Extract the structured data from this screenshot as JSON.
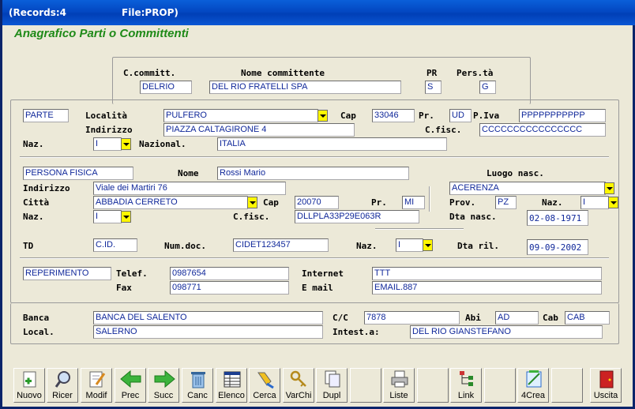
{
  "window": {
    "records": "(Records:4",
    "file": "File:PROP)"
  },
  "title": "Anagrafico Parti o Committenti",
  "header": {
    "ccomm_label": "C.committ.",
    "nome_label": "Nome committente",
    "pr_label": "PR",
    "pers_label": "Pers.tà",
    "ccomm": "DELRIO",
    "nome": "DEL RIO FRATELLI SPA",
    "pr": "S",
    "pers": "G"
  },
  "party": {
    "tipo": "PARTE",
    "localita_label": "Località",
    "localita": "PULFERO",
    "cap_label": "Cap",
    "cap": "33046",
    "pr_label": "Pr.",
    "pr": "UD",
    "piva_label": "P.Iva",
    "piva": "PPPPPPPPPPP",
    "indirizzo_label": "Indirizzo",
    "indirizzo": "PIAZZA CALTAGIRONE 4",
    "cfisc_label": "C.fisc.",
    "cfisc": "CCCCCCCCCCCCCCCC",
    "naz_label": "Naz.",
    "naz": "I",
    "nazional_label": "Nazional.",
    "nazional": "ITALIA"
  },
  "person": {
    "tipo": "PERSONA FISICA",
    "nome_label": "Nome",
    "nome": "Rossi Mario",
    "luogo_label": "Luogo nasc.",
    "luogo": "ACERENZA",
    "indirizzo_label": "Indirizzo",
    "indirizzo": "Viale dei Martiri 76",
    "citta_label": "Città",
    "citta": "ABBADIA CERRETO",
    "cap_label": "Cap",
    "cap": "20070",
    "pr_label": "Pr.",
    "pr": "MI",
    "prov_label": "Prov.",
    "prov": "PZ",
    "naz2_label": "Naz.",
    "naz2": "I",
    "naz_label": "Naz.",
    "naz": "I",
    "cfisc_label": "C.fisc.",
    "cfisc": "DLLPLA33P29E063R",
    "dtanasc_label": "Dta nasc.",
    "dtanasc": "02-08-1971"
  },
  "doc": {
    "td_label": "TD",
    "td": "C.ID.",
    "numdoc_label": "Num.doc.",
    "numdoc": "CIDET123457",
    "naz_label": "Naz.",
    "naz": "I",
    "dtaril_label": "Dta ril.",
    "dtaril": "09-09-2002"
  },
  "contact": {
    "reperimento": "REPERIMENTO",
    "telef_label": "Telef.",
    "telef": "0987654",
    "fax_label": "Fax",
    "fax": "098771",
    "internet_label": "Internet",
    "internet": "TTT",
    "email_label": "E mail",
    "email": "EMAIL.887"
  },
  "bank": {
    "banca_label": "Banca",
    "banca": "BANCA DEL SALENTO",
    "cc_label": "C/C",
    "cc": "7878",
    "abi_label": "Abi",
    "abi": "AD",
    "cab_label": "Cab",
    "cab": "CAB",
    "local_label": "Local.",
    "local": "SALERNO",
    "intest_label": "Intest.a:",
    "intest": "DEL RIO GIANSTEFANO"
  },
  "toolbar": {
    "nuovo": "Nuovo",
    "ricer": "Ricer",
    "modif": "Modif",
    "prec": "Prec",
    "succ": "Succ",
    "canc": "Canc",
    "elenco": "Elenco",
    "cerca": "Cerca",
    "varchi": "VarChi",
    "dupl": "Dupl",
    "liste": "Liste",
    "link": "Link",
    "crea": "4Crea",
    "uscita": "Uscita"
  }
}
